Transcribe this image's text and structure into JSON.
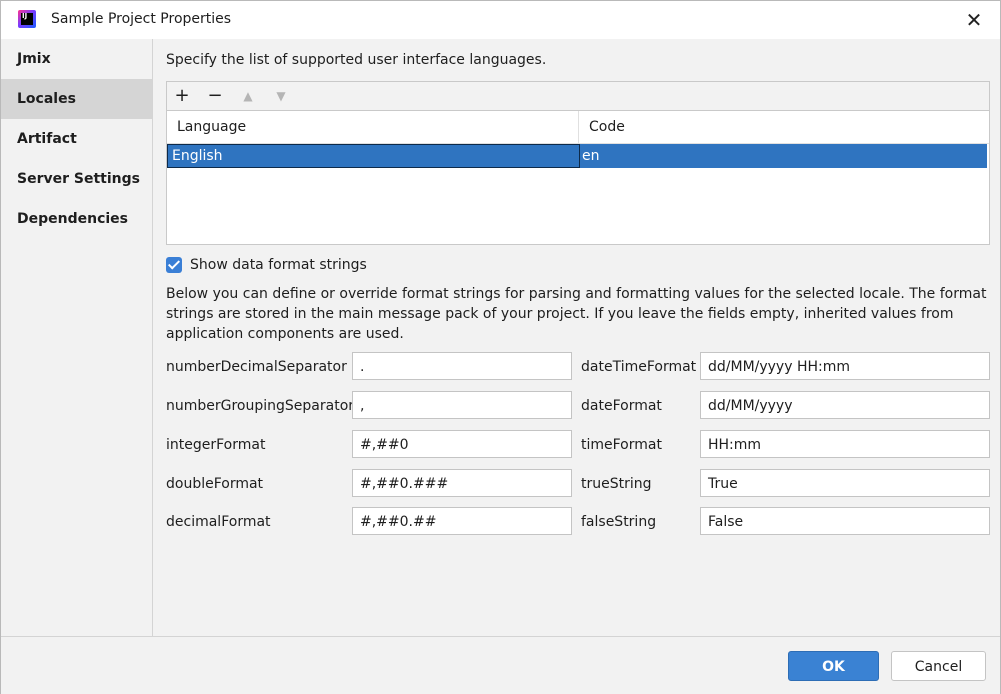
{
  "window": {
    "title": "Sample Project Properties",
    "app_icon": "intellij-icon",
    "app_icon_text": "IJ",
    "close_glyph": "✕"
  },
  "sidebar": {
    "items": [
      {
        "label": "Jmix",
        "active": false
      },
      {
        "label": "Locales",
        "active": true
      },
      {
        "label": "Artifact",
        "active": false
      },
      {
        "label": "Server Settings",
        "active": false
      },
      {
        "label": "Dependencies",
        "active": false
      }
    ]
  },
  "locales": {
    "intro": "Specify the list of supported user interface languages.",
    "toolbar": {
      "add": "+",
      "remove": "−",
      "up": "▲",
      "down": "▼"
    },
    "columns": [
      "Language",
      "Code"
    ],
    "rows": [
      {
        "language": "English",
        "code": "en",
        "selected": true
      }
    ]
  },
  "format": {
    "checkbox_label": "Show data format strings",
    "checked": true,
    "description": "Below you can define or override format strings for parsing and formatting values for the selected locale. The format strings are stored in the main message pack of your project. If you leave the fields empty, inherited values from application components are used.",
    "left": [
      {
        "label": "numberDecimalSeparator",
        "value": "."
      },
      {
        "label": "numberGroupingSeparator",
        "value": ","
      },
      {
        "label": "integerFormat",
        "value": "#,##0"
      },
      {
        "label": "doubleFormat",
        "value": "#,##0.###"
      },
      {
        "label": "decimalFormat",
        "value": "#,##0.##"
      }
    ],
    "right": [
      {
        "label": "dateTimeFormat",
        "value": "dd/MM/yyyy HH:mm"
      },
      {
        "label": "dateFormat",
        "value": "dd/MM/yyyy"
      },
      {
        "label": "timeFormat",
        "value": "HH:mm"
      },
      {
        "label": "trueString",
        "value": "True"
      },
      {
        "label": "falseString",
        "value": "False"
      }
    ]
  },
  "footer": {
    "ok_label": "OK",
    "cancel_label": "Cancel"
  },
  "colors": {
    "accent": "#3a82d3",
    "selection": "#2f74c0",
    "sidebar_active": "#d5d5d5",
    "background": "#f2f2f2"
  }
}
